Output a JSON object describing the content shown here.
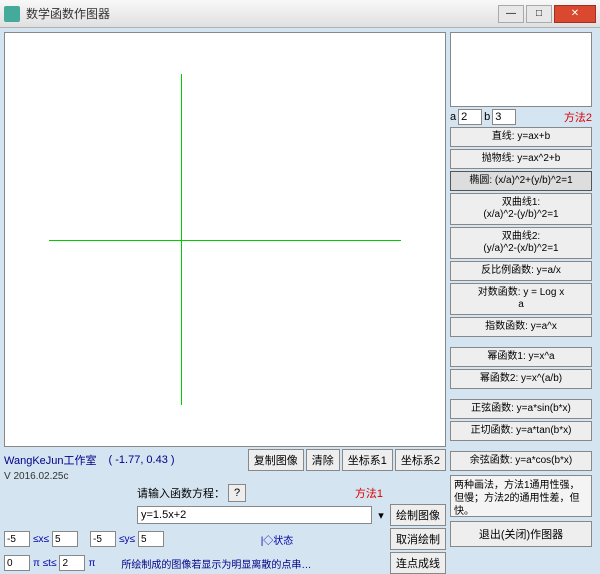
{
  "window": {
    "title": "数学函数作图器"
  },
  "status": {
    "workshop": "WangKeJun工作室",
    "coord": "( -1.77, 0.43 )",
    "version": "V 2016.02.25c"
  },
  "toolbar": {
    "copy": "复制图像",
    "clear": "清除",
    "axis1": "坐标系1",
    "axis2": "坐标系2"
  },
  "equation": {
    "prompt": "请输入函数方程：",
    "help": "?",
    "method1": "方法1",
    "value": "y=1.5x+2",
    "draw": "绘制图像",
    "cancel": "取消绘制",
    "connect": "连点成线",
    "state_label": "|◇状态",
    "hint": "所绘制成的图像若显示为明显离散的点串…"
  },
  "ranges": {
    "x_lo": "-5",
    "x_mid": "≤x≤",
    "x_hi": "5",
    "y_lo": "-5",
    "y_mid": "≤y≤",
    "y_hi": "5",
    "t_lo": "0",
    "t_mid1": "π ≤t≤",
    "t_hi": "2",
    "t_mid2": "π"
  },
  "right": {
    "a_label": "a",
    "a_value": "2",
    "b_label": "b",
    "b_value": "3",
    "method2": "方法2",
    "fns": [
      "直线: y=ax+b",
      "抛物线: y=ax^2+b",
      "椭圆: (x/a)^2+(y/b)^2=1",
      "双曲线1:\n(x/a)^2-(y/b)^2=1",
      "双曲线2:\n(y/a)^2-(x/b)^2=1",
      "反比例函数: y=a/x",
      "对数函数: y = Log x\n                a",
      "指数函数: y=a^x",
      "幂函数1: y=x^a",
      "幂函数2: y=x^(a/b)",
      "正弦函数: y=a*sin(b*x)",
      "正切函数: y=a*tan(b*x)",
      "余弦函数: y=a*cos(b*x)"
    ],
    "notes": "两种画法，方法1通用性强，但慢；方法2的通用性差，但快。",
    "exit": "退出(关闭)作图器"
  }
}
